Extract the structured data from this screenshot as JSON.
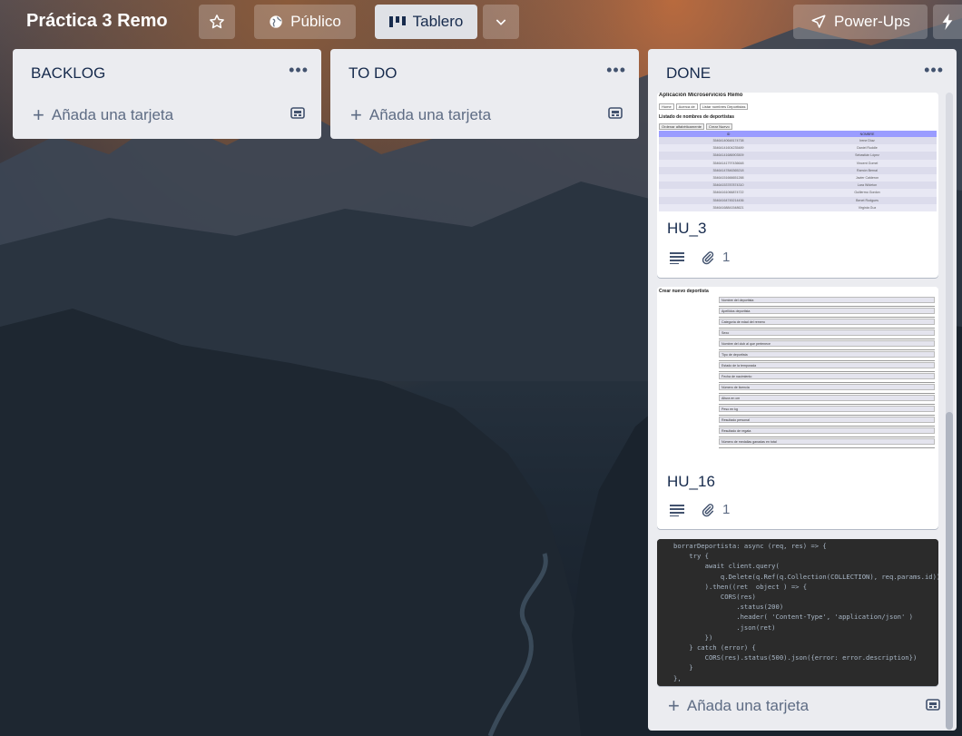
{
  "board": {
    "title": "Práctica 3 Remo",
    "visibility_label": "Público",
    "view_label": "Tablero",
    "powerups_label": "Power-Ups"
  },
  "icons": {
    "star": "star-icon",
    "globe": "globe-icon",
    "board": "board-icon",
    "chevron": "chevron-down-icon",
    "rocket": "rocket-icon",
    "bolt": "bolt-icon"
  },
  "lists": [
    {
      "title": "BACKLOG",
      "add_label": "Añada una tarjeta"
    },
    {
      "title": "TO DO",
      "add_label": "Añada una tarjeta"
    },
    {
      "title": "DONE",
      "add_label": "Añada una tarjeta"
    }
  ],
  "cards": [
    {
      "title": "HU_3",
      "attachments": "1",
      "preview": {
        "heading": "Aplicación Microservicios Remo",
        "nav": [
          "Home",
          "Acerca de",
          "Listar nombres Deportistas"
        ],
        "subheading": "Listado de nombres de deportistas",
        "buttons": [
          "Ordenar alfabéticamente",
          "Crear Nuevo"
        ],
        "columns": [
          "ID",
          "NOMBRE"
        ],
        "rows": [
          [
            "35464140648174738",
            "Irene Díaz"
          ],
          [
            "35464141604235489",
            "Daniel Ruddle"
          ],
          [
            "35464141686903509",
            "Sebastián López"
          ],
          [
            "35464141797436648",
            "Vincent Gomel"
          ],
          [
            "35464147846365218",
            "Ramón Bernal"
          ],
          [
            "35464151666651288",
            "Javier Calderon"
          ],
          [
            "35464153787874310",
            "Lara Wideton"
          ],
          [
            "35464161066874722",
            "Guillermo Gordon"
          ],
          [
            "35464164745214436",
            "Benet Rodgues"
          ],
          [
            "35464168841548621",
            "Virginia Guz"
          ]
        ]
      }
    },
    {
      "title": "HU_16",
      "attachments": "1",
      "preview": {
        "heading": "Crear nuevo deportista",
        "fields": [
          "Nombre del deportista",
          "Apellidos deportista",
          "Categoría de edad del remero",
          "Sexo",
          "Nombre del club al que pertenece",
          "Tipo de deportista",
          "Estado de la temporada",
          "Fecha de nacimiento",
          "Número de licencia",
          "Altura en cm",
          "Peso en kg",
          "Resultado personal",
          "Resultado de regata",
          "Número de medallas ganadas en total"
        ]
      }
    },
    {
      "code": [
        "borrarDeportista: async (req, res) => {",
        "    try {",
        "        await client.query(",
        "            q.Delete(q.Ref(q.Collection(COLLECTION), req.params.id))",
        "        ).then((ret  object ) => {",
        "            CORS(res)",
        "                .status(200)",
        "                .header( 'Content-Type', 'application/json' )",
        "                .json(ret)",
        "        })",
        "    } catch (error) {",
        "        CORS(res).status(500).json({error: error.description})",
        "    }",
        "},"
      ]
    }
  ]
}
